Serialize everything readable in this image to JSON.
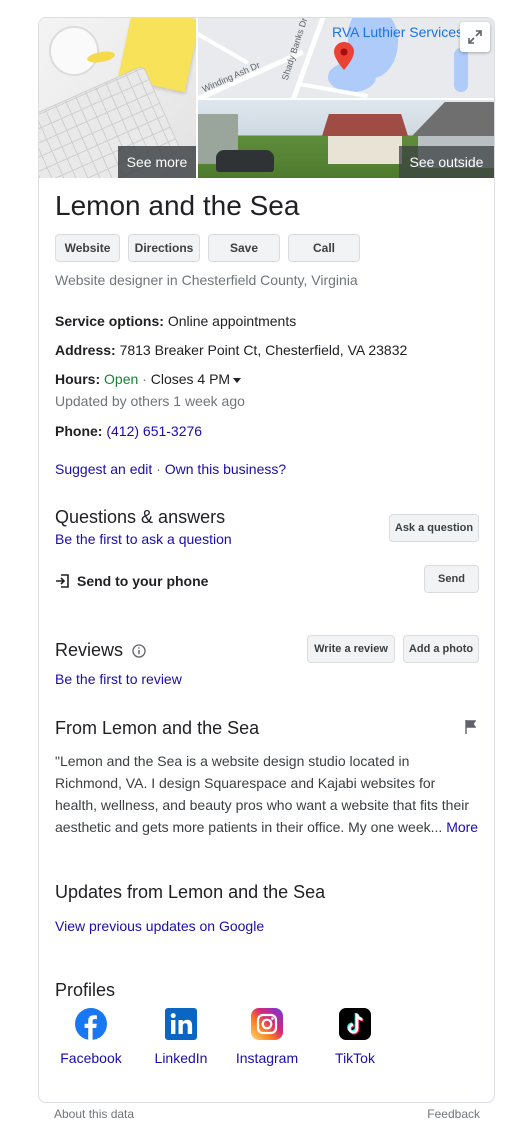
{
  "photos": {
    "see_more_label": "See more",
    "map_place_label": "RVA Luthier Services",
    "map_street_1": "Winding Ash Dr",
    "map_street_2": "Shady Banks Dr",
    "see_outside_label": "See outside"
  },
  "business": {
    "name": "Lemon and the Sea",
    "category": "Website designer in Chesterfield County, Virginia"
  },
  "actions": [
    "Website",
    "Directions",
    "Save",
    "Call"
  ],
  "details": {
    "service_label": "Service options:",
    "service_value": "Online appointments",
    "address_label": "Address:",
    "address_value": "7813 Breaker Point Ct, Chesterfield, VA 23832",
    "hours_label": "Hours:",
    "hours_status": "Open",
    "hours_sep": " · ",
    "hours_close": "Closes 4 PM",
    "hours_updated": "Updated by others 1 week ago",
    "phone_label": "Phone:",
    "phone_value": "(412) 651-3276"
  },
  "edit_links": {
    "suggest": "Suggest an edit",
    "sep": " · ",
    "own": "Own this business?"
  },
  "qa": {
    "heading": "Questions & answers",
    "first_link": "Be the first to ask a question",
    "ask_button": "Ask a question"
  },
  "send": {
    "label": "Send to your phone",
    "button": "Send"
  },
  "reviews": {
    "heading": "Reviews",
    "first_link": "Be the first to review",
    "write_button": "Write a review",
    "photo_button": "Add a photo"
  },
  "from": {
    "heading": "From Lemon and the Sea",
    "text": "\"Lemon and the Sea is a website design studio located in Richmond, VA. I design Squarespace and Kajabi websites for health, wellness, and beauty pros who want a website that fits their aesthetic and gets more patients in their office. My one week... ",
    "more": "More"
  },
  "updates": {
    "heading": "Updates from Lemon and the Sea",
    "link": "View previous updates on Google"
  },
  "profiles": {
    "heading": "Profiles",
    "items": [
      {
        "label": "Facebook",
        "icon": "facebook-icon",
        "color": "#1877f2"
      },
      {
        "label": "LinkedIn",
        "icon": "linkedin-icon",
        "color": "#0a66c2"
      },
      {
        "label": "Instagram",
        "icon": "instagram-icon",
        "color": "#c13584"
      },
      {
        "label": "TikTok",
        "icon": "tiktok-icon",
        "color": "#000000"
      }
    ]
  },
  "footer": {
    "about": "About this data",
    "feedback": "Feedback"
  }
}
